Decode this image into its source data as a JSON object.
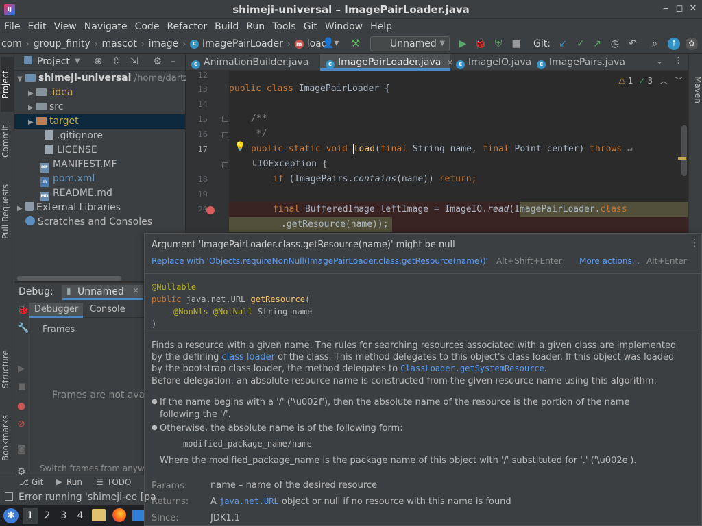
{
  "window": {
    "title": "shimeji-universal – ImagePairLoader.java",
    "minimize": "‒",
    "restore": "◻",
    "close": "✕"
  },
  "menu": [
    "File",
    "Edit",
    "View",
    "Navigate",
    "Code",
    "Refactor",
    "Build",
    "Run",
    "Tools",
    "Git",
    "Window",
    "Help"
  ],
  "breadcrumbs": [
    "com",
    "group_finity",
    "mascot",
    "image",
    "ImagePairLoader",
    "load"
  ],
  "toolbar": {
    "run_config": "Unnamed",
    "git_label": "Git:"
  },
  "project": {
    "header": "Project",
    "root": "shimeji-universal",
    "root_path": "/home/dartz",
    "items": [
      ".idea",
      "src",
      "target",
      ".gitignore",
      "LICENSE",
      "MANIFEST.MF",
      "pom.xml",
      "README.md",
      "External Libraries",
      "Scratches and Consoles"
    ]
  },
  "stripe": {
    "project": "Project",
    "commit": "Commit",
    "pull_requests": "Pull Requests",
    "structure": "Structure",
    "bookmarks": "Bookmarks",
    "maven": "Maven"
  },
  "debug": {
    "label": "Debug:",
    "config": "Unnamed",
    "tab_debugger": "Debugger",
    "tab_console": "Console",
    "frames": "Frames",
    "empty": "Frames are not avail",
    "hint": "Switch frames from anywh"
  },
  "bottom_tabs": {
    "git": "Git",
    "run": "Run",
    "todo": "TODO"
  },
  "status": {
    "message": "Error running 'shimeji-ee [pa"
  },
  "taskbar": {
    "workspaces": [
      "1",
      "2",
      "3",
      "4"
    ]
  },
  "editor": {
    "tabs": [
      "AnimationBuilder.java",
      "ImagePairLoader.java",
      "ImageIO.java",
      "ImagePairs.java"
    ],
    "warnings": "1",
    "weak": "3",
    "line_numbers": [
      "12",
      "13",
      "14",
      "15",
      "16",
      "17",
      "",
      "18",
      "19",
      "20",
      ""
    ],
    "code": {
      "l13_kw": "public class ",
      "l13_name": "ImagePairLoader {",
      "l15": "/**",
      "l16": " */",
      "l17_kw": "public static void ",
      "l17_fn": "load",
      "l17_a": "(",
      "l17_kw2": "final ",
      "l17_b": "String name, ",
      "l17_kw3": "final ",
      "l17_c": "Point center) ",
      "l17_kw4": "throws",
      "l17w": "IOException {",
      "l18_kw": "if ",
      "l18_a": "(ImagePairs.",
      "l18_it": "contains",
      "l18_b": "(name)) ",
      "l18_kw2": "return;",
      "l20_kw": "final ",
      "l20_a": "BufferedImage leftImage = ImageIO.",
      "l20_it": "read",
      "l20_b": "(ImagePairLoader.",
      "l20_kw2": "class",
      "l20w": ".getResource(name));"
    }
  },
  "doc": {
    "warning": "Argument 'ImagePairLoader.class.getResource(name)' might be null",
    "fix": "Replace with 'Objects.requireNonNull(ImagePairLoader.class.getResource(name))'",
    "fix_shortcut": "Alt+Shift+Enter",
    "more_actions": "More actions...",
    "more_shortcut": "Alt+Enter",
    "sig1": "@Nullable",
    "sig2_kw": "public ",
    "sig2_a": "java.net.URL ",
    "sig2_fn": "getResource",
    "sig2_b": "(",
    "sig3_ann": "@NonNls @NotNull ",
    "sig3_b": "String name",
    "sig4": ")",
    "p1a": "Finds a resource with a given name. The rules for searching resources associated with a given class are implemented",
    "p1b_a": "by the defining ",
    "p1b_link": "class loader",
    "p1b_b": " of the class. This method delegates to this object's class loader. If this object was loaded",
    "p1c_a": "by the bootstrap class loader, the method delegates to ",
    "p1c_code": "ClassLoader.getSystemResource",
    "p1c_b": ".",
    "p1d": "Before delegation, an absolute resource name is constructed from the given resource name using this algorithm:",
    "b1a": "If the name begins with a '/' ('\\u002f'), then the absolute name of the resource is the portion of the name",
    "b1b": "following the '/'.",
    "b2": "Otherwise, the absolute name is of the following form:",
    "b2code": "modified_package_name/name",
    "b2c": "Where the modified_package_name is the package name of this object with '/' substituted for '.' ('\\u002e').",
    "params_label": "Params:",
    "params_val": "name – name of the desired resource",
    "returns_label": "Returns:",
    "returns_a": "A ",
    "returns_code": "java.net.URL",
    "returns_b": " object or null if no resource with this name is found",
    "since_label": "Since:",
    "since_val": "JDK1.1"
  }
}
